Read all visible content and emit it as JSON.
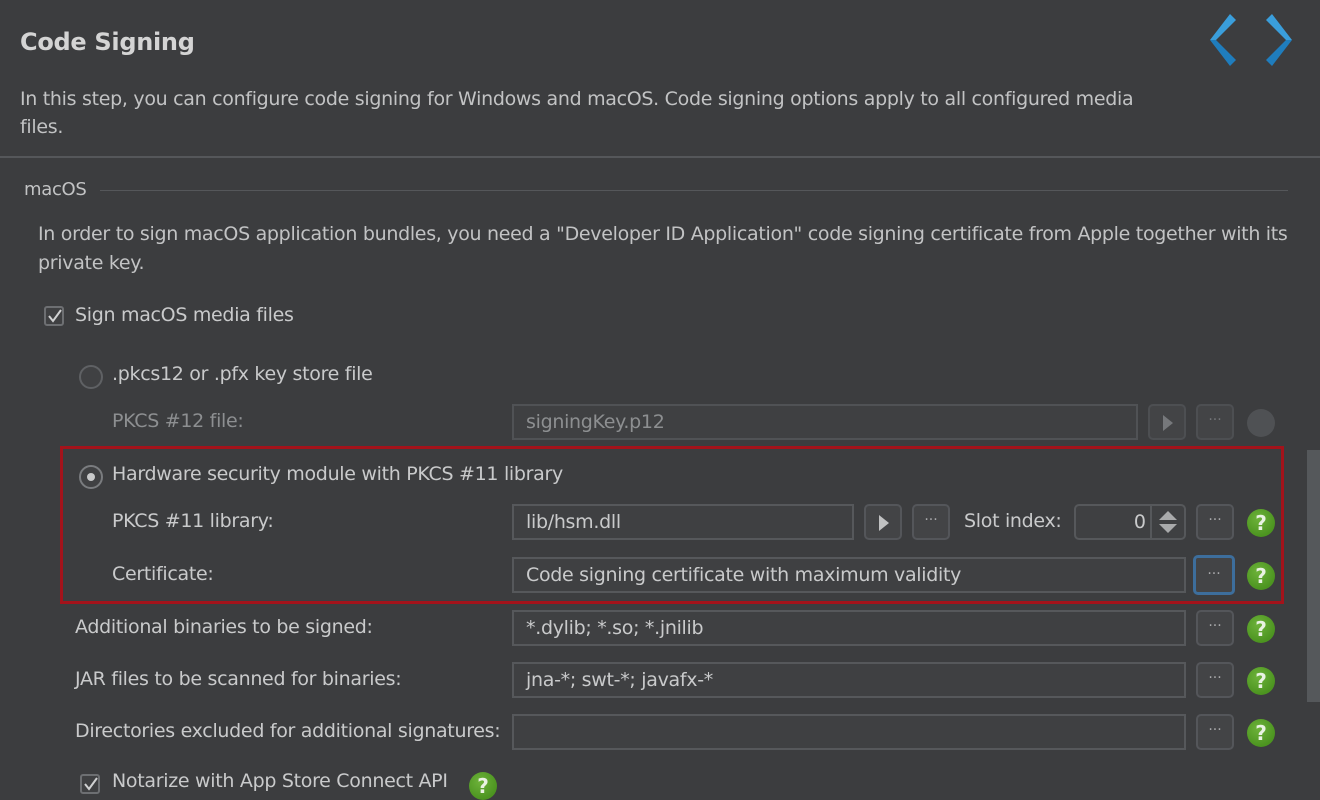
{
  "header": {
    "title": "Code Signing",
    "description": "In this step, you can configure code signing for Windows and macOS. Code signing options apply to all configured media files.",
    "nav": {
      "prev_icon": "chevron-left-icon",
      "next_icon": "chevron-right-icon",
      "accent": "#2f8fcf"
    }
  },
  "macos": {
    "group_label": "macOS",
    "description": "In order to sign macOS application bundles, you need a \"Developer ID Application\" code signing certificate from Apple together with its private key.",
    "sign_checkbox": {
      "label": "Sign macOS media files",
      "checked": true
    },
    "pkcs12_option": {
      "label": ".pkcs12 or .pfx key store file",
      "selected": false,
      "file_label": "PKCS #12 file:",
      "file_value": "signingKey.p12"
    },
    "hsm_option": {
      "label": "Hardware security module with PKCS #11 library",
      "selected": true,
      "library_label": "PKCS #11 library:",
      "library_value": "lib/hsm.dll",
      "slot_label": "Slot index:",
      "slot_value": "0",
      "certificate_label": "Certificate:",
      "certificate_value": "Code signing certificate with maximum validity"
    },
    "additional_binaries": {
      "label": "Additional binaries to be signed:",
      "value": "*.dylib; *.so; *.jnilib"
    },
    "jar_files": {
      "label": "JAR files to be scanned for binaries:",
      "value": "jna-*; swt-*; javafx-*"
    },
    "excluded_dirs": {
      "label": "Directories excluded for additional signatures:",
      "value": ""
    },
    "notarize": {
      "label": "Notarize with App Store Connect API",
      "checked": true
    }
  },
  "buttons": {
    "more": "···",
    "help": "?"
  },
  "colors": {
    "highlight": "#a3131b",
    "help": "#5aa22b",
    "focus": "#3d6e9c"
  }
}
